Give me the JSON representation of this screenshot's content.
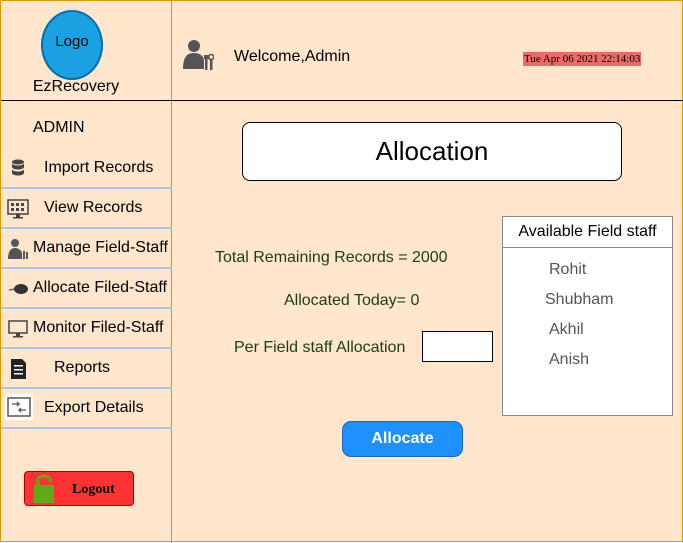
{
  "brand": {
    "logo_text": "Logo",
    "name": "EzRecovery"
  },
  "header": {
    "welcome": "Welcome,Admin",
    "datetime": "Tue Apr 06 2021 22:14:03"
  },
  "sidebar": {
    "role": "ADMIN",
    "items": [
      {
        "label": "Import Records",
        "icon": "database-icon"
      },
      {
        "label": "View Records",
        "icon": "monitor-grid-icon"
      },
      {
        "label": "Manage Field-Staff",
        "icon": "user-tools-icon"
      },
      {
        "label": "Allocate Filed-Staff",
        "icon": "mouse-icon"
      },
      {
        "label": "Monitor Filed-Staff",
        "icon": "monitor-icon"
      },
      {
        "label": "Reports",
        "icon": "document-icon"
      },
      {
        "label": "Export Details",
        "icon": "export-icon"
      }
    ],
    "logout_label": "Logout"
  },
  "main": {
    "title": "Allocation",
    "total_remaining": "Total Remaining Records = 2000",
    "allocated_today": "Allocated Today= 0",
    "per_staff_label": "Per Field staff Allocation",
    "per_staff_value": "",
    "allocate_button": "Allocate"
  },
  "staff_panel": {
    "heading": "Available Field staff",
    "staff": [
      "Rohit",
      "Shubham",
      "Akhil",
      "Anish"
    ]
  },
  "colors": {
    "background": "#ffe6cc",
    "logo": "#1ba1e2",
    "datetime_bg": "#ea6b66",
    "logout": "#ff3333",
    "allocate_button": "#1e90ff",
    "nav_divider": "#a9c4eb"
  }
}
